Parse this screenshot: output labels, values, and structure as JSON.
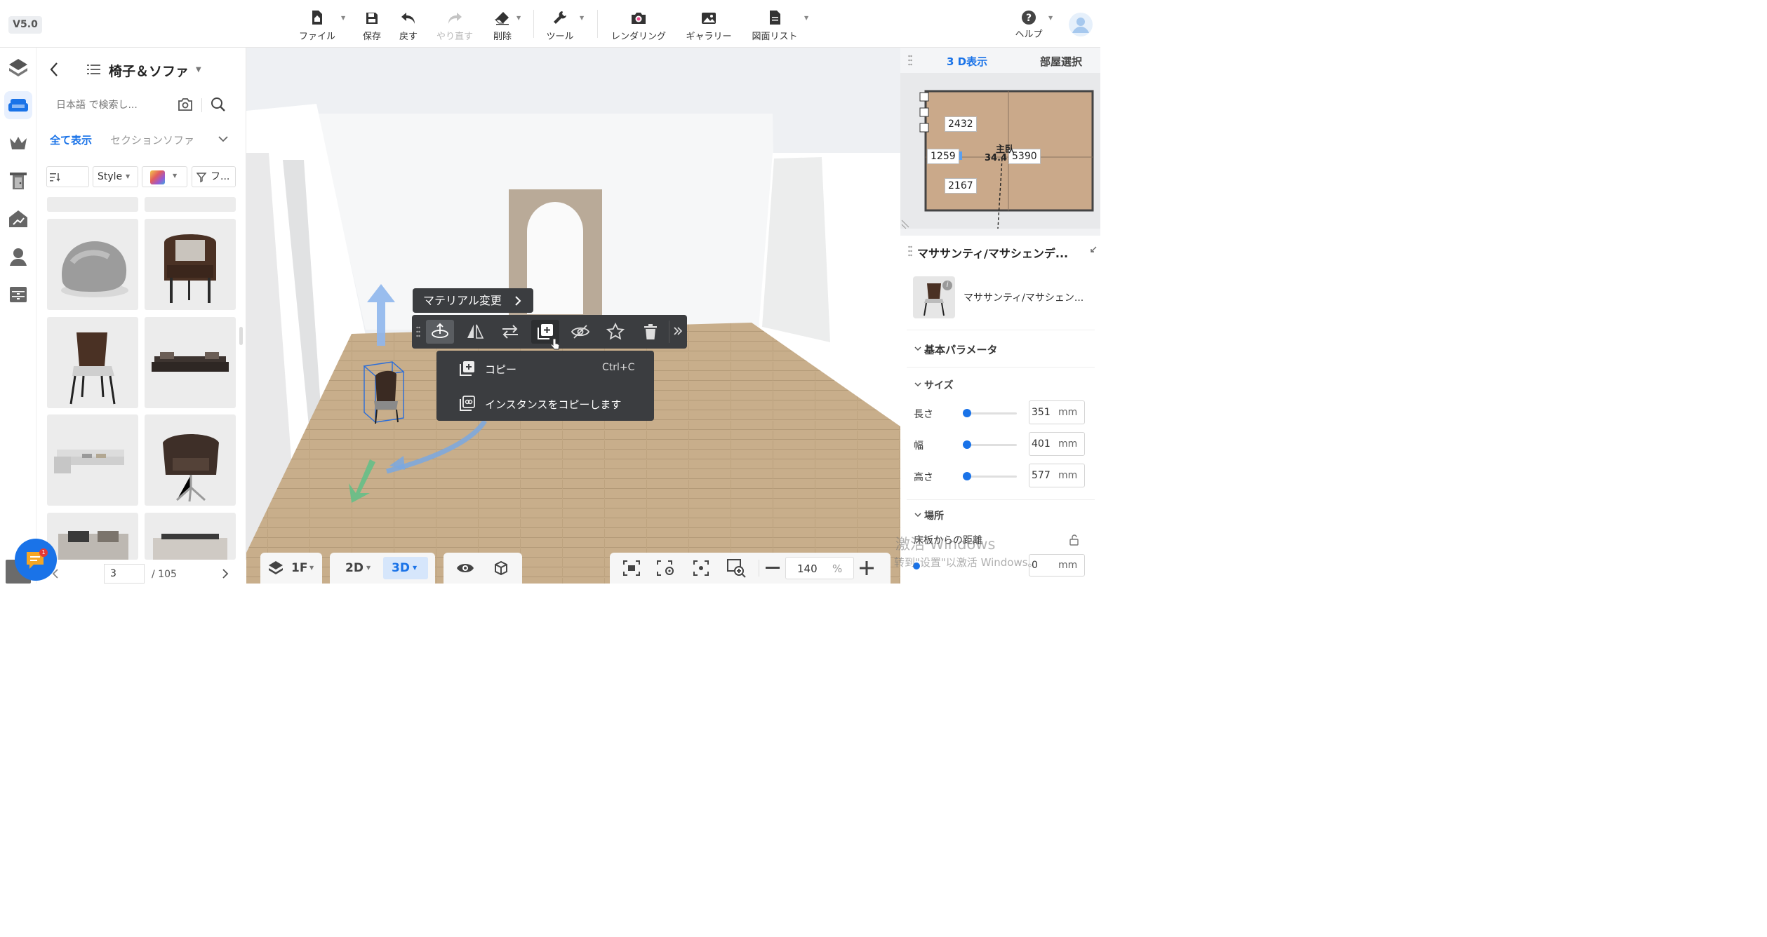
{
  "app": {
    "version": "V5.0"
  },
  "toolbar": {
    "file": "ファイル",
    "save": "保存",
    "undo": "戻す",
    "redo": "やり直す",
    "delete": "削除",
    "tools": "ツール",
    "rendering": "レンダリング",
    "gallery": "ギャラリー",
    "drawing_list": "図面リスト",
    "help": "ヘルプ"
  },
  "catalog": {
    "category_title": "椅子＆ソファ",
    "search_placeholder": "日本語 で検索し...",
    "tab_all": "全て表示",
    "tab_sectional": "セクションソファ",
    "filter_style": "Style",
    "filter_more": "フ...",
    "page_current": "3",
    "page_total": "/ 105",
    "items": [
      "ビーズクッション",
      "アームチェア",
      "ダイニングチェア",
      "ローソファ",
      "セクションソファ",
      "ラウンジチェア",
      "ソファ",
      "ソファセット"
    ]
  },
  "viewport": {
    "material_change": "マテリアル変更",
    "context_menu": {
      "copy": "コピー",
      "copy_shortcut": "Ctrl+C",
      "copy_instance": "インスタンスをコピーします"
    }
  },
  "right": {
    "tab_3d": "3 D表示",
    "tab_room": "部屋選択",
    "minimap": {
      "d1": "2432",
      "d2": "1259",
      "d3": "5390",
      "d4": "2167",
      "room_name": "主臥",
      "room_area": "34.47"
    },
    "product_title": "マササンティ/マサシェンデ...",
    "product_name": "マササンティ/マサシェン...",
    "section_basic": "基本パラメータ",
    "section_size": "サイズ",
    "length_label": "長さ",
    "length_value": "351",
    "width_label": "幅",
    "width_value": "401",
    "height_label": "高さ",
    "height_value": "577",
    "unit": "mm",
    "section_location": "場所",
    "floor_distance_label": "床板からの距離",
    "floor_distance_value": "0"
  },
  "bottom": {
    "floor": "1F",
    "view_2d": "2D",
    "view_3d": "3D",
    "zoom": "140",
    "zoom_unit": "%"
  },
  "watermark": {
    "line1": "激活 Windows",
    "line2": "转到\"设置\"以激活 Windows。"
  },
  "chat": {
    "badge": "1"
  },
  "colors": {
    "accent": "#1a73e8",
    "toolbar_dark": "#3b3d40",
    "floor": "#c7ad8a"
  }
}
